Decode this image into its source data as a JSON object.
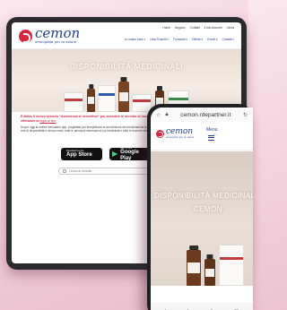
{
  "tablet": {
    "brand": "cemon",
    "tagline": "omeopatia per la salute",
    "top_nav": [
      "Home",
      "Negozio",
      "Contatti",
      "Il mio Account",
      "Cerca"
    ],
    "main_nav": [
      "Le nostre Aree ▾",
      "Lista Prodotti ▾",
      "Formulari ▾",
      "Offerte ▾",
      "Eventi ▾",
      "Contatti ▾"
    ],
    "hero_title": "DISPONIBILITÀ MEDICINALI",
    "alert": "E attivo il nuovo servizio \"Assistenza ai rivenditori\" per accedere al servizio di ricerca delle disponibilità dei medicinali è necessario effettuare la",
    "alert_link": "login al sito",
    "body_text": "Scopri oggi la nostra ricercatore app, progettata per semplificare la condivisione dei medicinali tra le farmacie del territorio. Scarica l'app gratuitamente e accedi a una rete di disponibilità in tempo reale, tutte le principali informazioni sui medicinali e tutte le ricerche dei medicinali più richiesti e ai medicinali.",
    "store_apple": {
      "small": "Download on the",
      "big": "App Store"
    },
    "store_google": {
      "small": "GET IT ON",
      "big": "Google Play"
    },
    "search_placeholder": "Cerca un rimedio"
  },
  "phone": {
    "url": "cemon.rdepartner.it",
    "brand": "cemon",
    "tagline": "omeopatia per la salute",
    "menu_label": "Menu",
    "hero_title": "DISPONIBILITÀ MEDICINALI",
    "hero_subtitle": "CEMON"
  },
  "colors": {
    "brand_red": "#d7263d",
    "brand_blue": "#1f3f8a"
  }
}
